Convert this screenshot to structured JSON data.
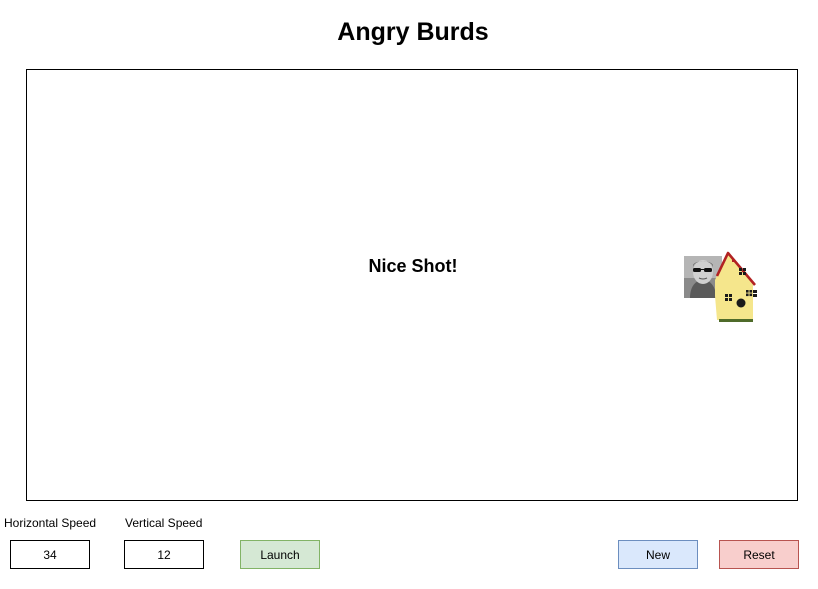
{
  "app": {
    "title": "Angry Burds"
  },
  "game": {
    "message": "Nice Shot!",
    "sprites": {
      "player": "player-photo-avatar",
      "target": "birdhouse-icon"
    },
    "colors": {
      "house_body": "#f5e68c",
      "roof": "#b22222",
      "ground": "#4f6b2a"
    }
  },
  "controls": {
    "horizontal_speed_label": "Horizontal Speed",
    "horizontal_speed_value": "34",
    "vertical_speed_label": "Vertical Speed",
    "vertical_speed_value": "12",
    "launch_label": "Launch",
    "new_label": "New",
    "reset_label": "Reset"
  },
  "theme": {
    "launch_color": "#d5e8d4",
    "new_color": "#dae8fc",
    "reset_color": "#f8cecc"
  }
}
